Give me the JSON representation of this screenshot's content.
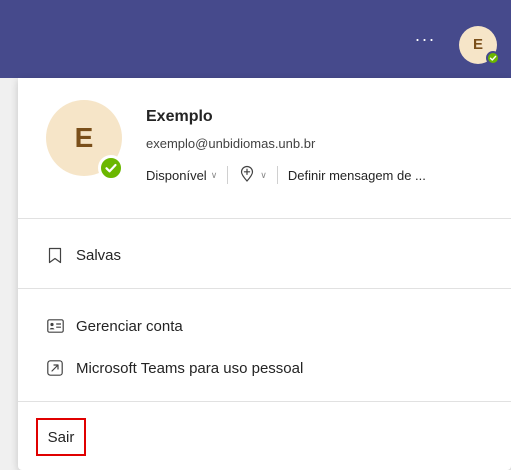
{
  "header": {
    "more_label": "···",
    "avatar_initial": "E",
    "background_color": "#464a8c"
  },
  "profile": {
    "avatar_initial": "E",
    "name": "Exemplo",
    "email": "exemplo@unbidiomas.unb.br",
    "status": "Disponível",
    "status_color": "#6bb700",
    "status_message": "Definir mensagem de ..."
  },
  "menu": {
    "saved": "Salvas",
    "manage_account": "Gerenciar conta",
    "teams_personal": "Microsoft Teams para uso pessoal",
    "sign_out": "Sair"
  },
  "icons": {
    "saved": "bookmark-icon",
    "manage_account": "id-card-icon",
    "teams_personal": "external-link-icon",
    "status": "check-icon",
    "location": "add-location-icon"
  }
}
